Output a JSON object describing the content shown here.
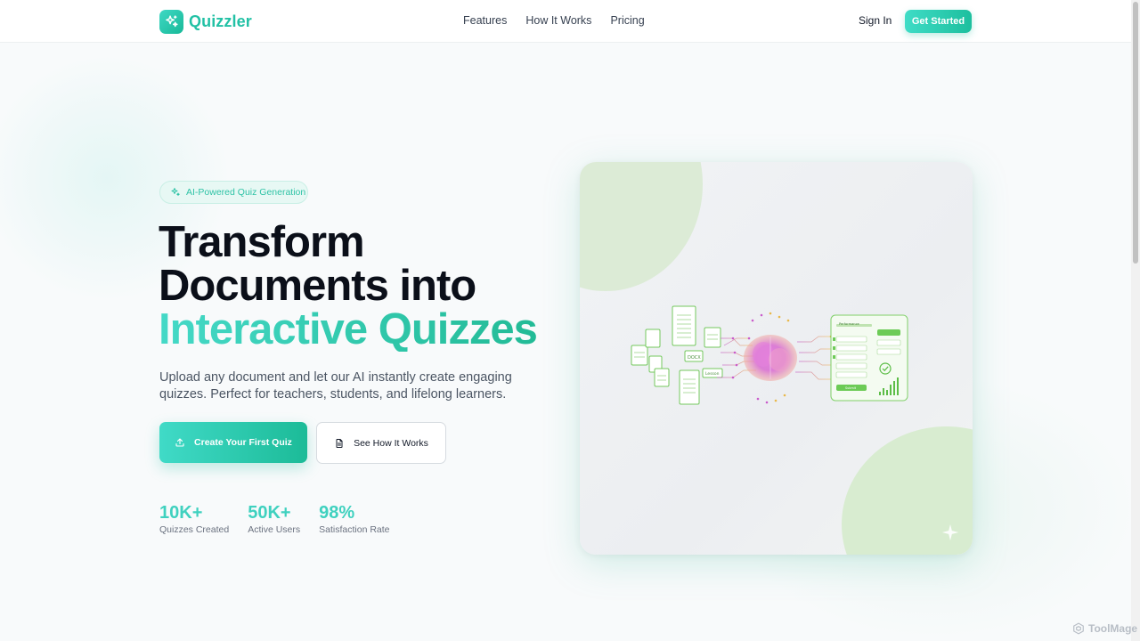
{
  "app": {
    "name": "Quizzler",
    "brand_color": "#22c1a5",
    "accent_gradient": [
      "#40dac7",
      "#1cbb98"
    ]
  },
  "nav": {
    "links": [
      "Features",
      "How It Works",
      "Pricing"
    ],
    "signin_label": "Sign In",
    "cta_label": "Get Started"
  },
  "hero": {
    "badge_icon": "sparkles-icon",
    "badge_label": "AI-Powered Quiz Generation",
    "title_line1": "Transform",
    "title_line2": "Documents into",
    "title_accent": "Interactive Quizzes",
    "subtitle": "Upload any document and let our AI instantly create engaging quizzes. Perfect for teachers, students, and lifelong learners.",
    "primary_button": {
      "icon": "upload-icon",
      "label": "Create Your First Quiz"
    },
    "secondary_button": {
      "icon": "document-icon",
      "label": "See How It Works"
    },
    "stats": [
      {
        "value": "10K+",
        "label": "Quizzes Created"
      },
      {
        "value": "50K+",
        "label": "Active Users"
      },
      {
        "value": "98%",
        "label": "Satisfaction Rate"
      }
    ]
  },
  "illustration": {
    "doc_tags": [
      "DOCX",
      "Lesson"
    ],
    "panel_title": "Performance",
    "panel_button": "Submit"
  },
  "watermark": "ToolMage"
}
